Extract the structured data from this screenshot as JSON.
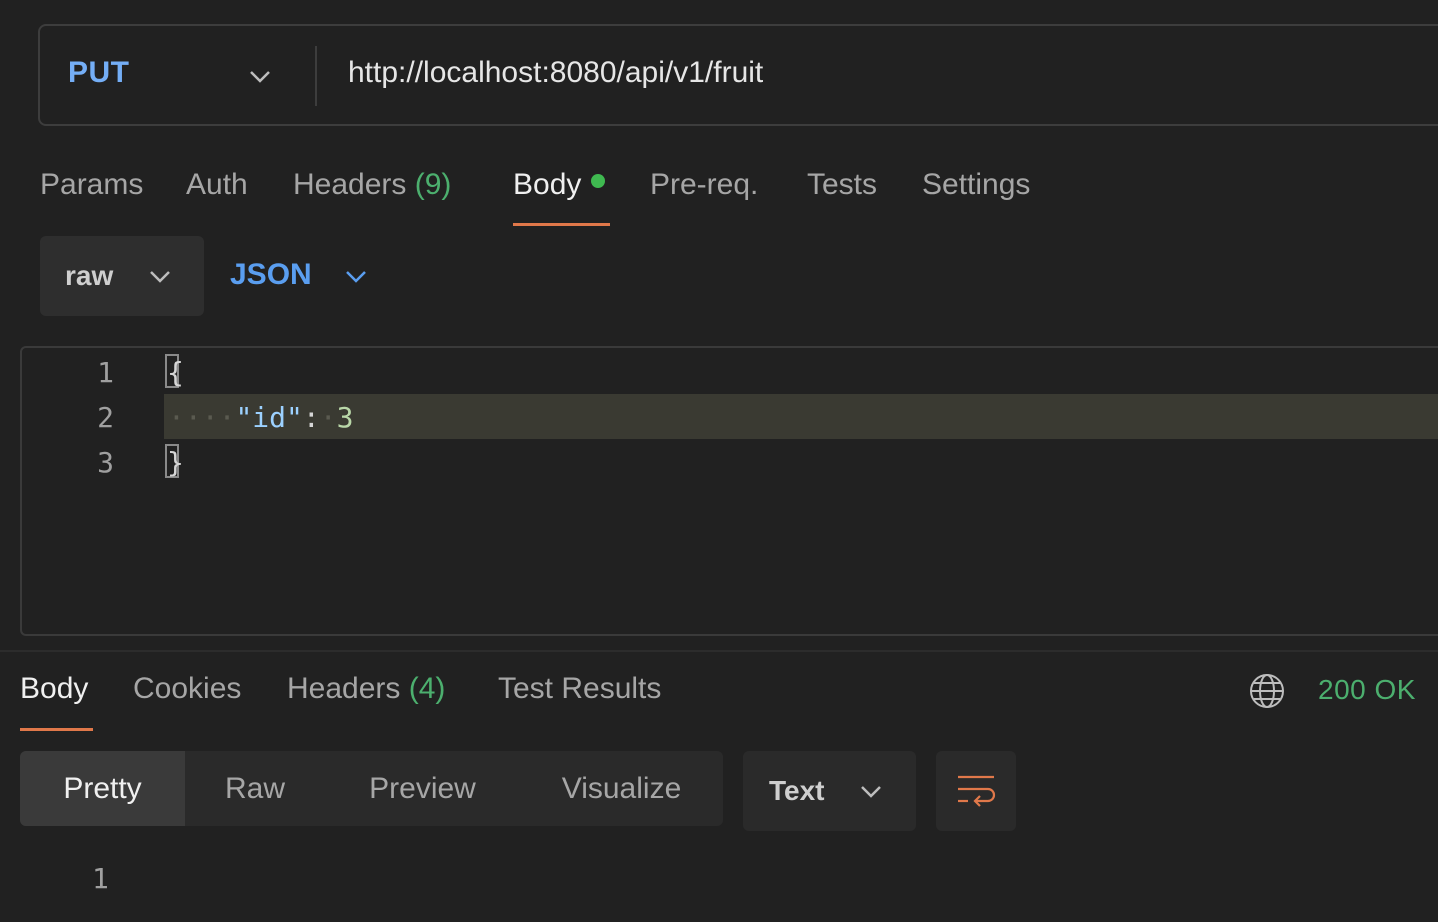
{
  "request": {
    "method": "PUT",
    "url": "http://localhost:8080/api/v1/fruit"
  },
  "request_tabs": [
    {
      "label": "Params"
    },
    {
      "label": "Auth"
    },
    {
      "label": "Headers",
      "count": "(9)"
    },
    {
      "label": "Body"
    },
    {
      "label": "Pre-req."
    },
    {
      "label": "Tests"
    },
    {
      "label": "Settings"
    }
  ],
  "body_type": {
    "mode": "raw",
    "language": "JSON"
  },
  "editor": {
    "line_numbers": [
      "1",
      "2",
      "3"
    ],
    "open_brace": "{",
    "close_brace": "}",
    "key": "\"id\"",
    "colon": ":",
    "value": "3"
  },
  "response_tabs": [
    {
      "label": "Body"
    },
    {
      "label": "Cookies"
    },
    {
      "label": "Headers",
      "count": "(4)"
    },
    {
      "label": "Test Results"
    }
  ],
  "status": "200 OK",
  "view_modes": [
    "Pretty",
    "Raw",
    "Preview",
    "Visualize"
  ],
  "response_format": "Text",
  "response_line_numbers": [
    "1"
  ],
  "colors": {
    "method": "#74aef6",
    "accent_underline": "#e0784a",
    "status_ok": "#4caf6e"
  }
}
